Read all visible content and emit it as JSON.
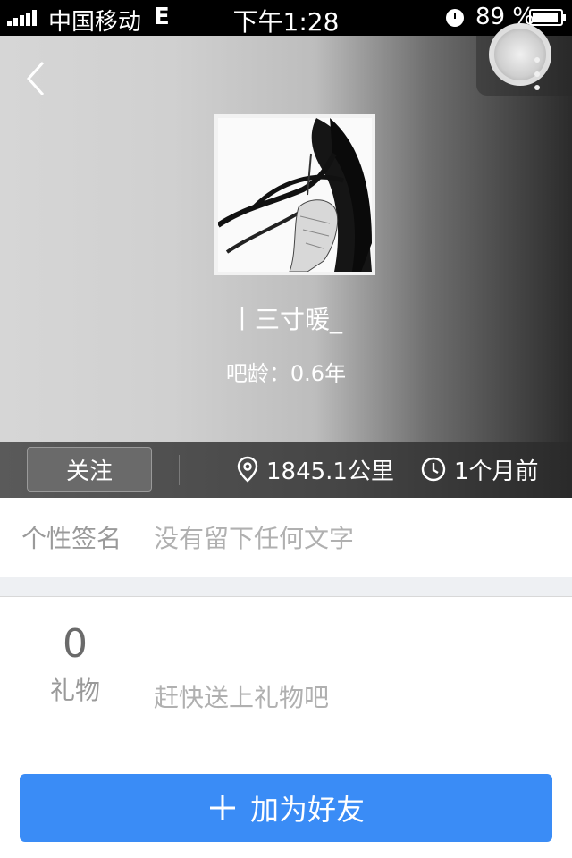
{
  "status_bar": {
    "carrier": "中国移动",
    "network": "E",
    "time": "下午1:28",
    "battery": "89 %"
  },
  "profile": {
    "name": "丨三寸暖_",
    "age": "吧龄：0.6年"
  },
  "info_bar": {
    "follow_label": "关注",
    "distance": "1845.1公里",
    "last_active": "1个月前"
  },
  "signature": {
    "label": "个性签名",
    "value": "没有留下任何文字"
  },
  "gifts": {
    "count": "0",
    "label": "礼物",
    "hint": "赶快送上礼物吧"
  },
  "add_friend": {
    "label": "加为好友"
  },
  "colors": {
    "accent": "#3a8cf6"
  },
  "icons": {
    "back": "back-icon",
    "location": "location-pin-icon",
    "clock": "clock-icon",
    "plus": "plus-icon"
  }
}
